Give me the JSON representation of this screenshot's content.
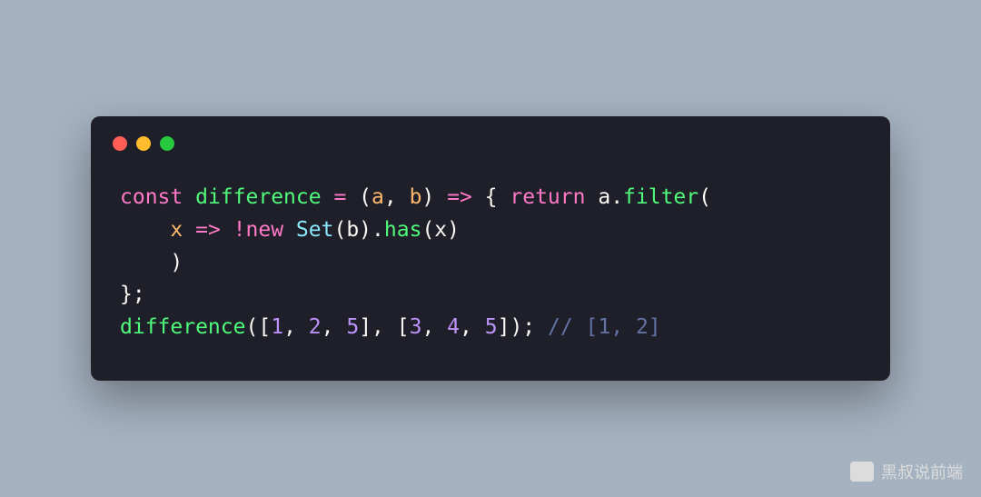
{
  "code": {
    "line1": {
      "const": "const",
      "name": "difference",
      "eq": " = ",
      "lparen": "(",
      "a": "a",
      "comma": ", ",
      "b": "b",
      "rparen": ")",
      "arrow": " => ",
      "lbrace": "{ ",
      "return": "return",
      "space": " ",
      "avar": "a",
      "dot": ".",
      "filter": "filter",
      "lparen2": "("
    },
    "line2": {
      "indent": "    ",
      "x": "x",
      "arrow": " => ",
      "bang": "!",
      "new": "new",
      "space": " ",
      "Set": "Set",
      "lparen": "(",
      "b": "b",
      "rparen": ")",
      "dot": ".",
      "has": "has",
      "lparen2": "(",
      "x2": "x",
      "rparen2": ")"
    },
    "line3": {
      "indent": "    ",
      "rparen": ")"
    },
    "line4": {
      "rbrace": "};"
    },
    "line5": {
      "fn": "difference",
      "lparen": "(",
      "lb1": "[",
      "n1": "1",
      "c1": ", ",
      "n2": "2",
      "c2": ", ",
      "n3": "5",
      "rb1": "]",
      "comma": ", ",
      "lb2": "[",
      "n4": "3",
      "c3": ", ",
      "n5": "4",
      "c4": ", ",
      "n6": "5",
      "rb2": "]",
      "rparen": ");",
      "space": " ",
      "comment": "// [1, 2]"
    }
  },
  "watermark": "黑叔说前端"
}
